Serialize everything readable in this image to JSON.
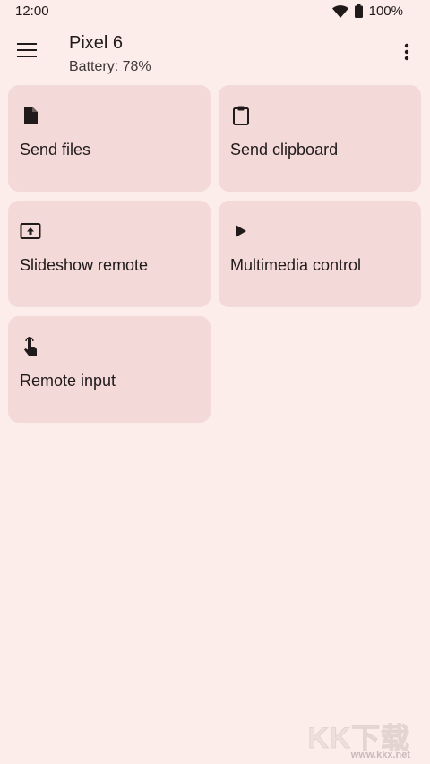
{
  "status_bar": {
    "time": "12:00",
    "battery_percent": "100%",
    "icons": [
      "wifi-icon",
      "battery-icon"
    ]
  },
  "app_bar": {
    "title": "Pixel 6",
    "subtitle": "Battery: 78%",
    "icons": [
      "menu-icon",
      "more-vert-icon"
    ]
  },
  "actions": [
    {
      "label": "Send files",
      "icon": "file-icon"
    },
    {
      "label": "Send clipboard",
      "icon": "clipboard-icon"
    },
    {
      "label": "Slideshow remote",
      "icon": "slideshow-icon"
    },
    {
      "label": "Multimedia control",
      "icon": "play-icon"
    },
    {
      "label": "Remote input",
      "icon": "touch-icon"
    }
  ],
  "watermark": {
    "big": "KK下载",
    "small": "www.kkx.net"
  },
  "colors": {
    "background": "#fcecea",
    "card": "#f3d9d7",
    "text": "#201a1a"
  }
}
